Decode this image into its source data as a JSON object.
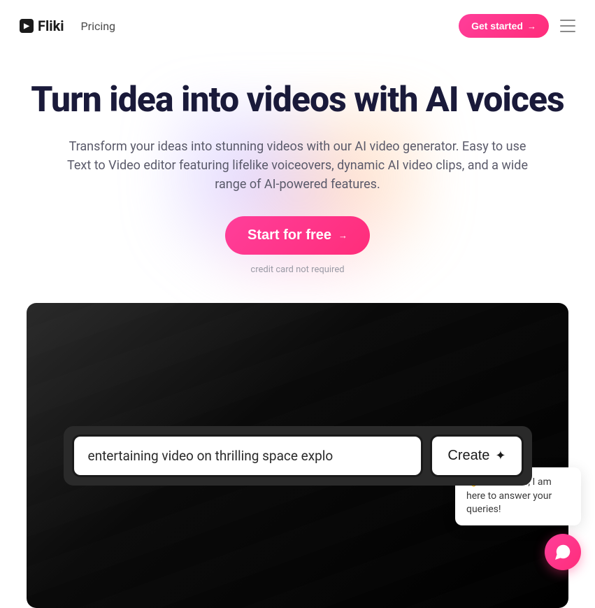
{
  "header": {
    "logo_text": "Fliki",
    "nav_pricing": "Pricing",
    "get_started_label": "Get started",
    "get_started_arrow": "→"
  },
  "hero": {
    "title": "Turn idea into videos with AI voices",
    "subtitle": "Transform your ideas into stunning videos with our AI video generator. Easy to use Text to Video editor featuring lifelike voiceovers, dynamic AI video clips, and a wide range of AI-powered features.",
    "cta_label": "Start for free",
    "cta_arrow": "→",
    "cc_note": "credit card not required"
  },
  "prompt": {
    "input_value": "entertaining video on thrilling space explo",
    "create_label": "Create",
    "sparkle": "✦"
  },
  "chat": {
    "tooltip_text": "👋 Hello there, I am here to answer your queries!"
  }
}
